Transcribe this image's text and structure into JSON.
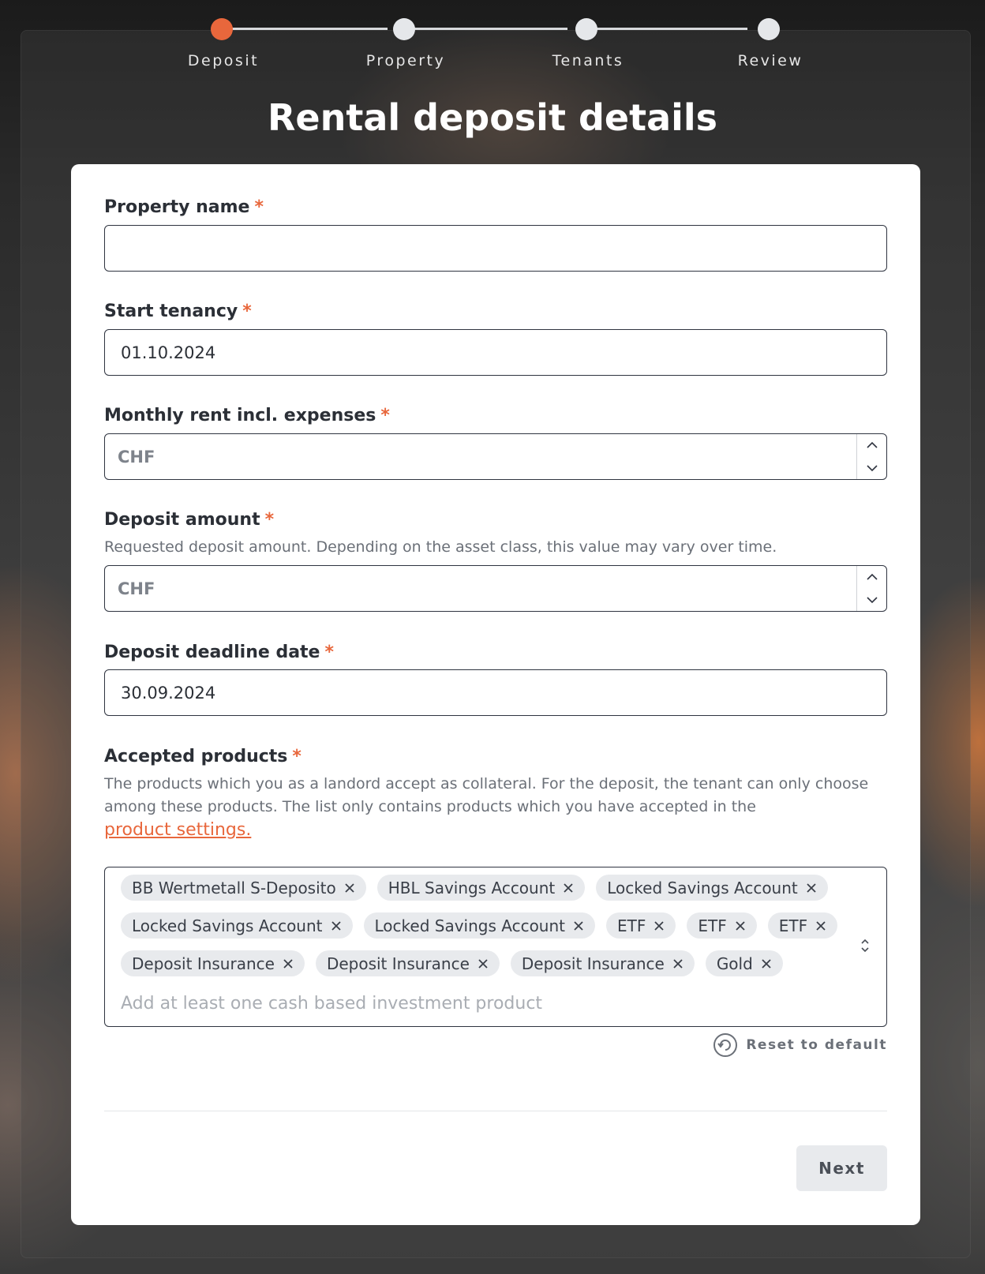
{
  "stepper": {
    "steps": [
      {
        "label": "Deposit",
        "active": true
      },
      {
        "label": "Property",
        "active": false
      },
      {
        "label": "Tenants",
        "active": false
      },
      {
        "label": "Review",
        "active": false
      }
    ]
  },
  "title": "Rental deposit details",
  "required_mark": "*",
  "fields": {
    "property_name": {
      "label": "Property name",
      "value": ""
    },
    "start_tenancy": {
      "label": "Start tenancy",
      "value": "01.10.2024"
    },
    "monthly_rent": {
      "label": "Monthly rent incl. expenses",
      "placeholder": "CHF"
    },
    "deposit_amount": {
      "label": "Deposit amount",
      "help": "Requested deposit amount. Depending on the asset class, this value may vary over time.",
      "placeholder": "CHF"
    },
    "deposit_deadline": {
      "label": "Deposit deadline date",
      "value": "30.09.2024"
    },
    "accepted_products": {
      "label": "Accepted products",
      "help": "The products which you as a landord accept as collateral. For the deposit, the tenant can only choose among these products. The list only contains products which you have accepted in the",
      "help_link": "product settings.",
      "tags": [
        [
          "BB Wertmetall S-Deposito",
          "HBL Savings Account",
          "Locked Savings Account"
        ],
        [
          "Locked Savings Account",
          "Locked Savings Account",
          "ETF",
          "ETF",
          "ETF"
        ],
        [
          "Deposit Insurance",
          "Deposit Insurance",
          "Deposit Insurance",
          "Gold"
        ]
      ],
      "placeholder": "Add at least one cash based investment product"
    }
  },
  "reset_label": "Reset to default",
  "next_label": "Next",
  "colors": {
    "accent": "#e8673c",
    "tag_bg": "#e8eaed"
  }
}
